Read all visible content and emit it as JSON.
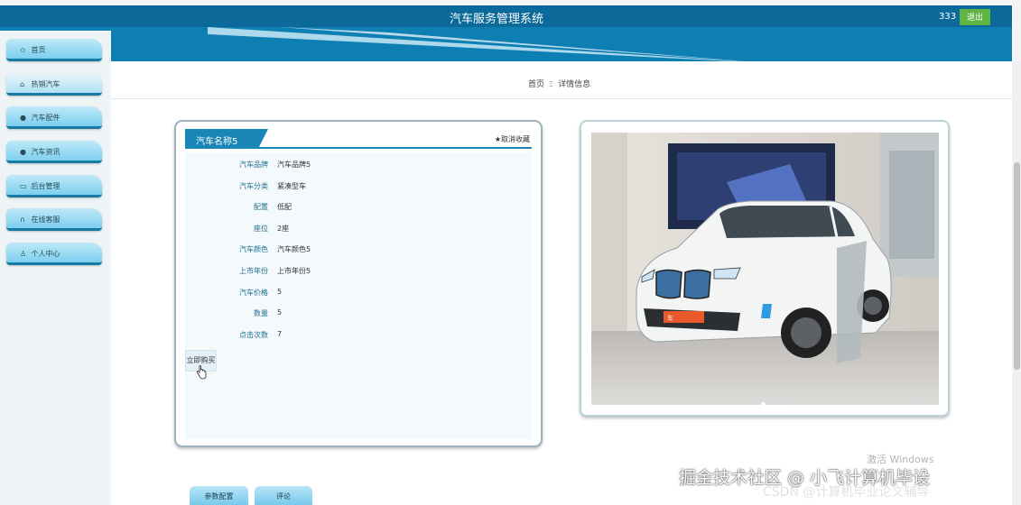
{
  "header": {
    "title": "汽车服务管理系统",
    "user": "333",
    "logout_label": "退出"
  },
  "sidebar": {
    "items": [
      {
        "label": "首页",
        "icon": "star-icon"
      },
      {
        "label": "热销汽车",
        "icon": "home-icon"
      },
      {
        "label": "汽车配件",
        "icon": "circle-icon"
      },
      {
        "label": "汽车资讯",
        "icon": "circle-icon"
      },
      {
        "label": "后台管理",
        "icon": "monitor-icon"
      },
      {
        "label": "在线客服",
        "icon": "headset-icon"
      },
      {
        "label": "个人中心",
        "icon": "user-icon"
      }
    ]
  },
  "breadcrumb": {
    "home": "首页",
    "separator": "Ξ",
    "current": "详情信息"
  },
  "detail": {
    "title": "汽车名称5",
    "favorite_label": "★取消收藏",
    "fields": [
      {
        "label": "汽车品牌",
        "value": "汽车品牌5"
      },
      {
        "label": "汽车分类",
        "value": "紧凑型车"
      },
      {
        "label": "配置",
        "value": "低配"
      },
      {
        "label": "座位",
        "value": "2座"
      },
      {
        "label": "汽车颜色",
        "value": "汽车颜色5"
      },
      {
        "label": "上市年份",
        "value": "上市年份5"
      },
      {
        "label": "汽车价格",
        "value": "5"
      },
      {
        "label": "数量",
        "value": "5"
      },
      {
        "label": "点击次数",
        "value": "7"
      }
    ],
    "buy_label": "立即购买"
  },
  "gallery": {
    "slide_count": 3,
    "active_slide": 1
  },
  "tabs": [
    {
      "label": "参数配置"
    },
    {
      "label": "评论"
    }
  ],
  "watermarks": {
    "windows": "激活 Windows",
    "juejin": "掘金技术社区 @ 小飞计算机毕设",
    "csdn": "CSDN @计算机毕业论文辅导"
  },
  "colors": {
    "header": "#0e7fb3",
    "accent": "#1a86b8",
    "logout": "#5fb442"
  }
}
